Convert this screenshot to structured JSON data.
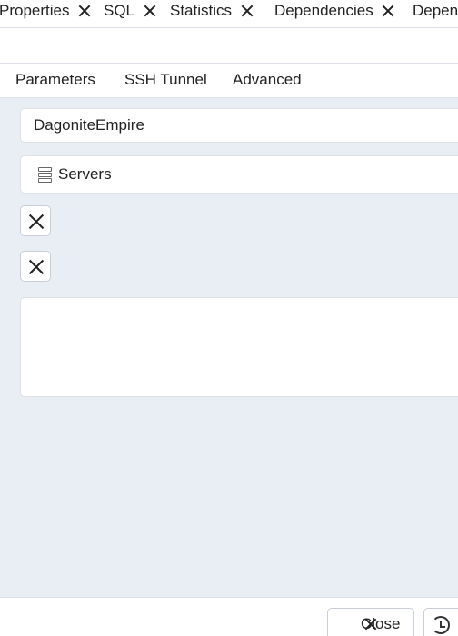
{
  "top_tabs": [
    {
      "label": "Properties"
    },
    {
      "label": "SQL"
    },
    {
      "label": "Statistics"
    },
    {
      "label": "Dependencies"
    },
    {
      "label": "Depen"
    }
  ],
  "sub_tabs": [
    {
      "label": "Parameters"
    },
    {
      "label": "SSH Tunnel"
    },
    {
      "label": "Advanced"
    }
  ],
  "form": {
    "name_value": "DagoniteEmpire",
    "server_group_value": "Servers",
    "server_group_icon": "server-icon"
  },
  "footer": {
    "close_label": "Close",
    "reset_icon": "reset-icon"
  }
}
